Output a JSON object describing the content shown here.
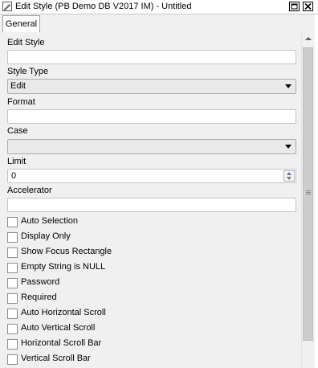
{
  "window": {
    "title": "Edit Style (PB Demo DB V2017 IM) - Untitled",
    "icon": "edit-pencil-icon",
    "buttons": {
      "restore": "restore-icon",
      "close": "close-icon"
    }
  },
  "tabs": [
    {
      "label": "General",
      "selected": true
    }
  ],
  "form": {
    "edit_style": {
      "label": "Edit Style",
      "value": ""
    },
    "style_type": {
      "label": "Style Type",
      "value": "Edit"
    },
    "format": {
      "label": "Format",
      "value": ""
    },
    "case": {
      "label": "Case",
      "value": ""
    },
    "limit": {
      "label": "Limit",
      "value": "0"
    },
    "accelerator": {
      "label": "Accelerator",
      "value": ""
    }
  },
  "checkboxes": [
    {
      "label": "Auto Selection",
      "checked": false
    },
    {
      "label": "Display Only",
      "checked": false
    },
    {
      "label": "Show Focus Rectangle",
      "checked": false
    },
    {
      "label": "Empty String is NULL",
      "checked": false
    },
    {
      "label": "Password",
      "checked": false
    },
    {
      "label": "Required",
      "checked": false
    },
    {
      "label": "Auto Horizontal Scroll",
      "checked": false
    },
    {
      "label": "Auto Vertical Scroll",
      "checked": false
    },
    {
      "label": "Horizontal Scroll Bar",
      "checked": false
    },
    {
      "label": "Vertical Scroll Bar",
      "checked": false
    }
  ],
  "colors": {
    "window_bg": "#f0f0f0",
    "field_bg": "#ffffff",
    "accent": "#5b7ba8"
  }
}
